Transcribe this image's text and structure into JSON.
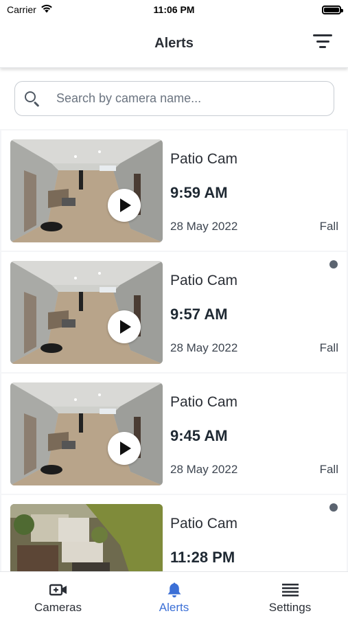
{
  "status_bar": {
    "carrier": "Carrier",
    "time": "11:06 PM",
    "battery_level": 1.0
  },
  "header": {
    "title": "Alerts",
    "filter_icon": "filter-icon"
  },
  "search": {
    "placeholder": "Search by camera name..."
  },
  "alerts": [
    {
      "camera": "Patio Cam",
      "time": "9:59 AM",
      "date": "28 May 2022",
      "type": "Fall",
      "unread": false,
      "scene": "hallway"
    },
    {
      "camera": "Patio Cam",
      "time": "9:57 AM",
      "date": "28 May 2022",
      "type": "Fall",
      "unread": true,
      "scene": "hallway"
    },
    {
      "camera": "Patio Cam",
      "time": "9:45 AM",
      "date": "28 May 2022",
      "type": "Fall",
      "unread": false,
      "scene": "hallway"
    },
    {
      "camera": "Patio Cam",
      "time": "11:28 PM",
      "date": "",
      "type": "",
      "unread": true,
      "scene": "patio"
    }
  ],
  "tabs": [
    {
      "label": "Cameras",
      "icon": "video-camera-icon",
      "active": false
    },
    {
      "label": "Alerts",
      "icon": "bell-icon",
      "active": true
    },
    {
      "label": "Settings",
      "icon": "menu-icon",
      "active": false
    }
  ],
  "colors": {
    "accent": "#3b6fd6",
    "text": "#2b2f36",
    "unread_dot": "#5b6470"
  }
}
